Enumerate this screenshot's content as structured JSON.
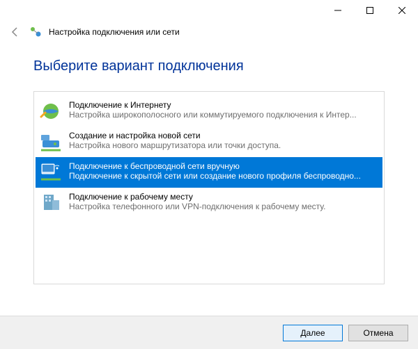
{
  "window": {
    "title": "Настройка подключения или сети"
  },
  "heading": "Выберите вариант подключения",
  "options": [
    {
      "title": "Подключение к Интернету",
      "subtitle": "Настройка широкополосного или коммутируемого подключения к Интер..."
    },
    {
      "title": "Создание и настройка новой сети",
      "subtitle": "Настройка нового маршрутизатора или точки доступа."
    },
    {
      "title": "Подключение к беспроводной сети вручную",
      "subtitle": "Подключение к скрытой сети или создание нового профиля беспроводно..."
    },
    {
      "title": "Подключение к рабочему месту",
      "subtitle": "Настройка телефонного или VPN-подключения к рабочему месту."
    }
  ],
  "buttons": {
    "next": "Далее",
    "cancel": "Отмена"
  }
}
